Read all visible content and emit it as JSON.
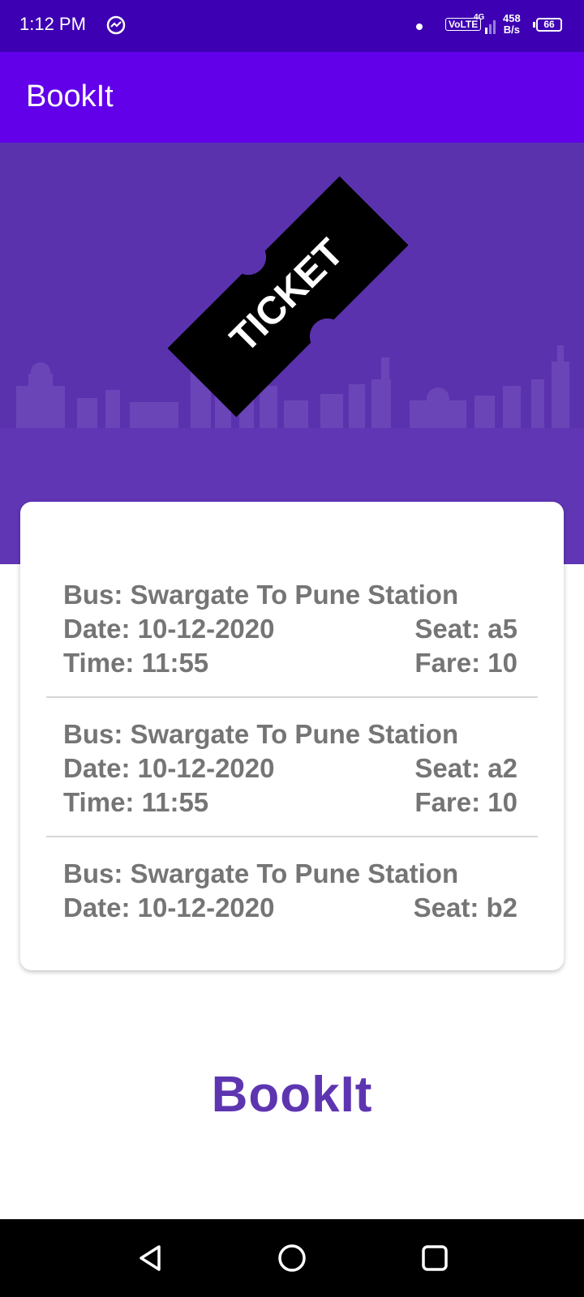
{
  "status_bar": {
    "time": "1:12 PM",
    "volte": "VoLTE",
    "network": "4G",
    "speed_value": "458",
    "speed_unit": "B/s",
    "battery": "66"
  },
  "app_bar": {
    "title": "BookIt"
  },
  "hero": {
    "ticket_text": "TICKET"
  },
  "bookings": [
    {
      "bus": "Bus: Swargate To Pune Station",
      "date": "Date: 10-12-2020",
      "seat": "Seat: a5",
      "time": "Time: 11:55",
      "fare": "Fare: 10"
    },
    {
      "bus": "Bus: Swargate To Pune Station",
      "date": "Date: 10-12-2020",
      "seat": "Seat: a2",
      "time": "Time: 11:55",
      "fare": "Fare: 10"
    },
    {
      "bus": "Bus: Swargate To Pune Station",
      "date": "Date: 10-12-2020",
      "seat": "Seat: b2"
    }
  ],
  "footer": {
    "logo": "BookIt"
  },
  "colors": {
    "status_bar": "#3d00b2",
    "app_bar": "#6200ea",
    "hero": "#5e35b1",
    "text": "#757575"
  },
  "nav": {
    "icons": [
      "back-icon",
      "home-icon",
      "recents-icon"
    ]
  }
}
